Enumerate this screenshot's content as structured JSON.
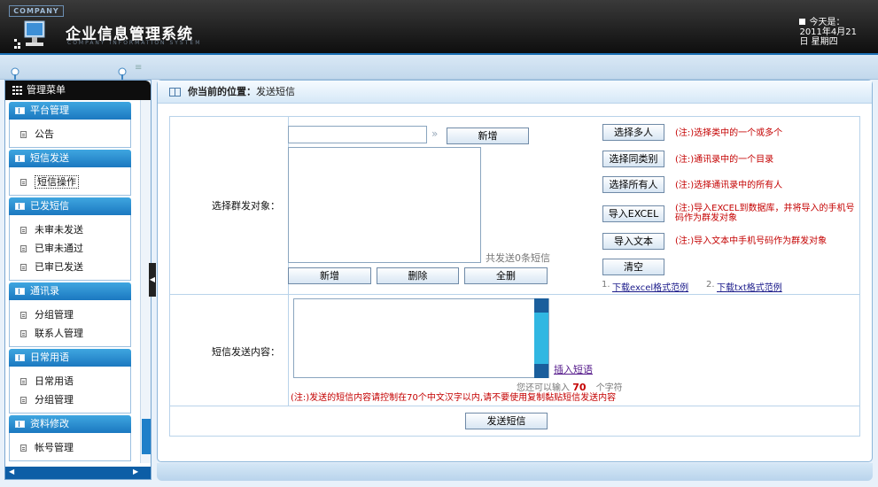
{
  "header": {
    "company": "COMPANY",
    "title": "企业信息管理系统",
    "subtitle": "COMPANY INFORMATION SYSTEM",
    "today_label": "今天是：",
    "date": "2011年4月21",
    "weekday": "日 星期四"
  },
  "sidebar": {
    "menu_title": "管理菜单",
    "sections": [
      {
        "title": "平台管理",
        "items": [
          "公告"
        ]
      },
      {
        "title": "短信发送",
        "items": [
          "短信操作"
        ]
      },
      {
        "title": "已发短信",
        "items": [
          "未审未发送",
          "已审未通过",
          "已审已发送"
        ]
      },
      {
        "title": "通讯录",
        "items": [
          "分组管理",
          "联系人管理"
        ]
      },
      {
        "title": "日常用语",
        "items": [
          "日常用语",
          "分组管理"
        ]
      },
      {
        "title": "资料修改",
        "items": [
          "帐号管理"
        ]
      }
    ]
  },
  "breadcrumb": {
    "label": "你当前的位置：",
    "current": "发送短信"
  },
  "form": {
    "target_label": "选择群发对象：",
    "add_top_button": "新增",
    "count_text": "共发送0条短信",
    "add_button": "新增",
    "delete_button": "删除",
    "delete_all_button": "全删",
    "select_multi_button": "选择多人",
    "select_multi_note": "(注:)选择类中的一个或多个",
    "select_category_button": "选择同类别",
    "select_category_note": "(注:)通讯录中的一个目录",
    "select_all_button": "选择所有人",
    "select_all_note": "(注:)选择通讯录中的所有人",
    "import_excel_button": "导入EXCEL",
    "import_excel_note": "(注:)导入EXCEL到数据库，并将导入的手机号码作为群发对象",
    "import_text_button": "导入文本",
    "import_text_note": "(注:)导入文本中手机号码作为群发对象",
    "clear_button": "清空",
    "excel_link_num": "1.",
    "excel_link": "下载excel格式范例",
    "txt_link_num": "2.",
    "txt_link": "下载txt格式范例",
    "content_label": "短信发送内容：",
    "insert_phrase": "插入短语",
    "remaining_prefix": "您还可以输入",
    "remaining_count": "70",
    "remaining_suffix": "个字符",
    "content_note": "(注:)发送的短信内容请控制在70个中文汉字以内,请不要使用复制黏贴短信发送内容",
    "send_button": "发送短信"
  },
  "colors": {
    "accent": "#1b78c0",
    "header_bg": "#0e0e0e",
    "note_red": "#c40000"
  }
}
